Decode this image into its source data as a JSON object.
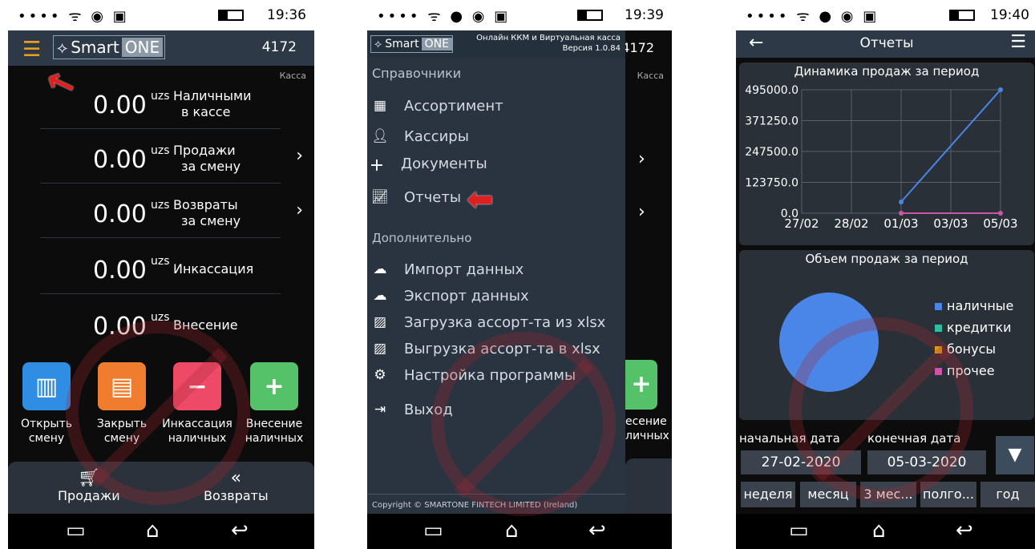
{
  "phone1": {
    "status_time": "19:36",
    "logo_main": "Smart",
    "logo_one": "ONE",
    "store_code": "4172",
    "kassa_label": "Касса",
    "rows": [
      {
        "value": "0.00",
        "currency": "uzs",
        "label1": "Наличными",
        "label2": "в кассе"
      },
      {
        "value": "0.00",
        "currency": "uzs",
        "label1": "Продажи",
        "label2": "за смену"
      },
      {
        "value": "0.00",
        "currency": "uzs",
        "label1": "Возвраты",
        "label2": "за смену"
      },
      {
        "value": "0.00",
        "currency": "uzs",
        "label1": "Инкассация",
        "label2": ""
      },
      {
        "value": "0.00",
        "currency": "uzs",
        "label1": "Внесение",
        "label2": ""
      }
    ],
    "actions": [
      {
        "line1": "Открыть",
        "line2": "смену",
        "color": "#2f8de4"
      },
      {
        "line1": "Закрыть",
        "line2": "смену",
        "color": "#f07c2e"
      },
      {
        "line1": "Инкассация",
        "line2": "наличных",
        "color": "#ee4a66"
      },
      {
        "line1": "Внесение",
        "line2": "наличных",
        "color": "#55c26a"
      }
    ],
    "tabs": {
      "sales": "Продажи",
      "returns": "Возвраты"
    }
  },
  "phone2": {
    "status_time": "19:39",
    "logo_main": "Smart",
    "logo_one": "ONE",
    "version_line1": "Онлайн ККМ и Виртуальная касса",
    "version_line2": "Версия 1.0.84",
    "store_code": "4172",
    "kassa_label": "Касса",
    "section_references": "Справочники",
    "menu_references": [
      {
        "label": "Ассортимент",
        "icon": "grid-icon"
      },
      {
        "label": "Кассиры",
        "icon": "person-icon"
      },
      {
        "label": "Документы",
        "icon": "plus-icon"
      },
      {
        "label": "Отчеты",
        "icon": "chart-icon"
      }
    ],
    "section_additional": "Дополнительно",
    "menu_additional": [
      {
        "label": "Импорт данных",
        "icon": "cloud-download-icon"
      },
      {
        "label": "Экспорт данных",
        "icon": "cloud-upload-icon"
      },
      {
        "label": "Загрузка ассорт-та из xlsx",
        "icon": "excel-file-icon"
      },
      {
        "label": "Выгрузка ассорт-та в xlsx",
        "icon": "excel-file-icon"
      },
      {
        "label": "Настройка программы",
        "icon": "gears-icon"
      },
      {
        "label": "Выход",
        "icon": "exit-icon"
      }
    ],
    "partial_action_line1": "есение",
    "partial_action_line2": "личных",
    "copyright": "Copyright © SMARTONE FINTECH LIMITED (Ireland)"
  },
  "phone3": {
    "status_time": "19:40",
    "title": "Отчеты",
    "line_chart_title": "Динамика продаж за период",
    "pie_chart_title": "Объем продаж за период",
    "start_label": "начальная дата",
    "end_label": "конечная дата",
    "start_date": "27-02-2020",
    "end_date": "05-03-2020",
    "periods": [
      "неделя",
      "месяц",
      "3 мес...",
      "полго...",
      "год"
    ]
  },
  "chart_data": [
    {
      "type": "line",
      "title": "Динамика продаж за период",
      "categories": [
        "27/02",
        "28/02",
        "01/03",
        "03/03",
        "05/03"
      ],
      "y_ticks": [
        "0.0",
        "123750.0",
        "247500.0",
        "371250.0",
        "495000.0"
      ],
      "ylim": [
        0,
        495000
      ],
      "grid": true,
      "series": [
        {
          "color": "#4a86e8",
          "points": [
            {
              "x": "01/03",
              "y": 45000
            },
            {
              "x": "05/03",
              "y": 495000
            }
          ]
        },
        {
          "color": "#cc55aa",
          "points": [
            {
              "x": "01/03",
              "y": 0
            },
            {
              "x": "05/03",
              "y": 0
            }
          ]
        }
      ]
    },
    {
      "type": "pie",
      "title": "Объем продаж за период",
      "legend_position": "right",
      "slices": [
        {
          "name": "наличные",
          "value": 100,
          "color": "#4a86e8"
        },
        {
          "name": "кредитки",
          "value": 0,
          "color": "#2bbf9f"
        },
        {
          "name": "бонусы",
          "value": 0,
          "color": "#f2c81a"
        },
        {
          "name": "прочее",
          "value": 0,
          "color": "#cc55aa"
        }
      ]
    }
  ]
}
